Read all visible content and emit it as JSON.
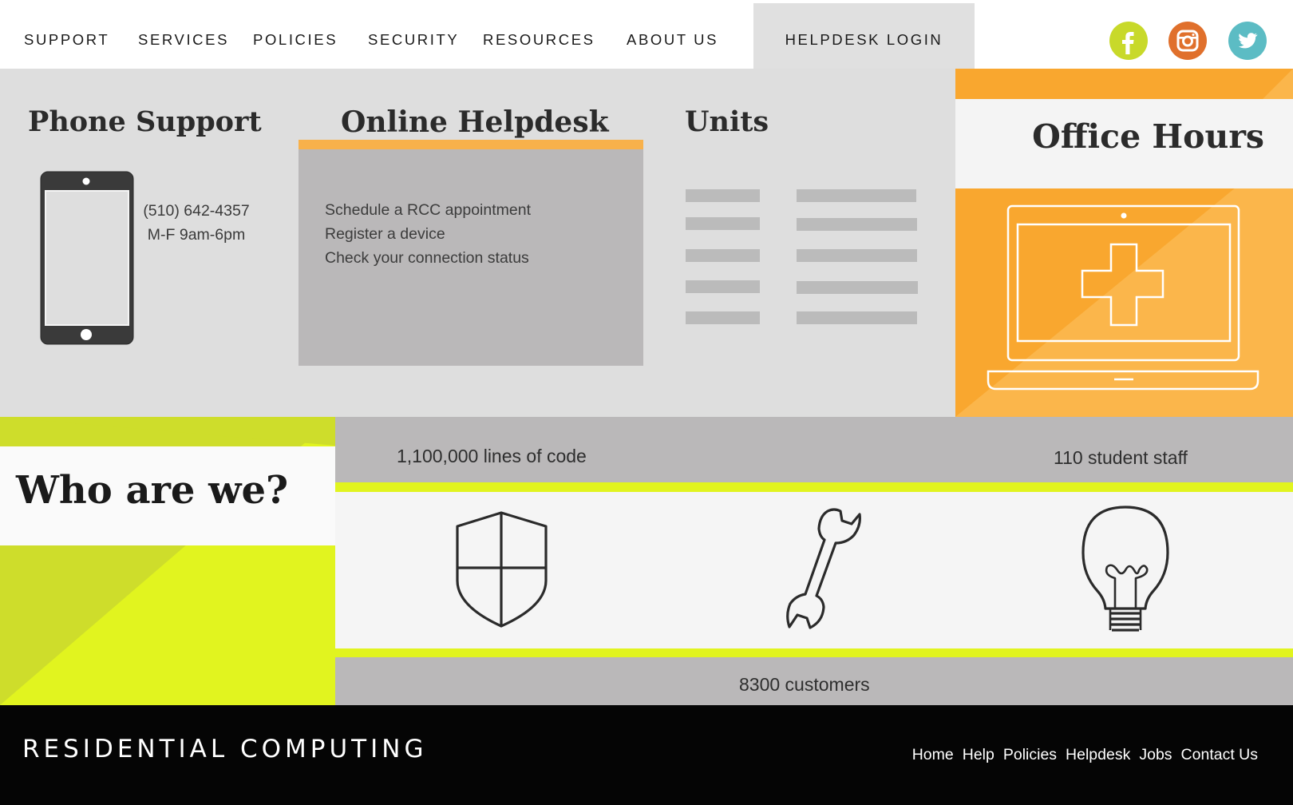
{
  "nav": {
    "items": [
      "SUPPORT",
      "SERVICES",
      "POLICIES",
      "SECURITY",
      "RESOURCES",
      "ABOUT US"
    ],
    "login_label": "HELPDESK LOGIN"
  },
  "social": [
    {
      "name": "facebook-icon",
      "color": "#c8d92a",
      "glyph": "f"
    },
    {
      "name": "instagram-icon",
      "color": "#e0702c"
    },
    {
      "name": "twitter-icon",
      "color": "#5cbcc4"
    }
  ],
  "phone_support": {
    "heading": "Phone Support",
    "number": "(510) 642-4357",
    "hours": "M-F 9am-6pm"
  },
  "online_helpdesk": {
    "heading": "Online Helpdesk",
    "links": [
      "Schedule a RCC appointment",
      "Register a device",
      "Check your connection status"
    ]
  },
  "units": {
    "heading": "Units"
  },
  "office_hours": {
    "heading": "Office Hours"
  },
  "who": {
    "heading": "Who are we?",
    "stat_code": "1,100,000 lines of code",
    "stat_staff": "110 student staff",
    "stat_customers": "8300 customers"
  },
  "footer": {
    "brand": "RESIDENTIAL COMPUTING",
    "links": [
      "Home",
      "Help",
      "Policies",
      "Helpdesk",
      "Jobs",
      "Contact Us"
    ]
  },
  "colors": {
    "orange": "#f9a72f",
    "lime": "#e1f41f",
    "gray_panel": "#bab8b9",
    "light_gray": "#dedede"
  }
}
